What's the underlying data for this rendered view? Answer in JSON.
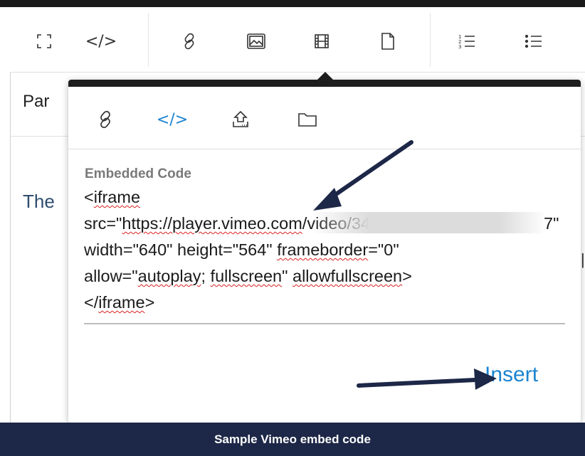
{
  "toolbar": {
    "buttons": [
      {
        "icon": "fullscreen-icon"
      },
      {
        "icon": "code-icon",
        "glyph": "</>"
      },
      {
        "icon": "link-icon"
      },
      {
        "icon": "image-icon"
      },
      {
        "icon": "video-icon"
      },
      {
        "icon": "file-icon"
      },
      {
        "icon": "numbered-list-icon"
      },
      {
        "icon": "bullet-list-icon"
      }
    ]
  },
  "editor": {
    "paragraph_label": "Par",
    "bg_text": "The"
  },
  "popover": {
    "tabs": [
      {
        "icon": "link-icon",
        "active": false
      },
      {
        "icon": "code-icon",
        "glyph": "</>",
        "active": true
      },
      {
        "icon": "upload-icon",
        "active": false
      },
      {
        "icon": "folder-icon",
        "active": false
      }
    ],
    "field_label": "Embedded Code",
    "code_lines": [
      "<iframe",
      "src=\"https://player.vimeo.com/video/34",
      "7\"",
      "width=\"640\" height=\"564\" frameborder=\"0\"",
      "allow=\"autoplay; fullscreen\" allowfullscreen>",
      "</iframe>"
    ],
    "insert_label": "Insert"
  },
  "caption": "Sample Vimeo embed code",
  "colors": {
    "accent": "#1c83cf",
    "caption_bg": "#1d2747",
    "arrow": "#1d2747",
    "squiggle": "#d92020"
  }
}
